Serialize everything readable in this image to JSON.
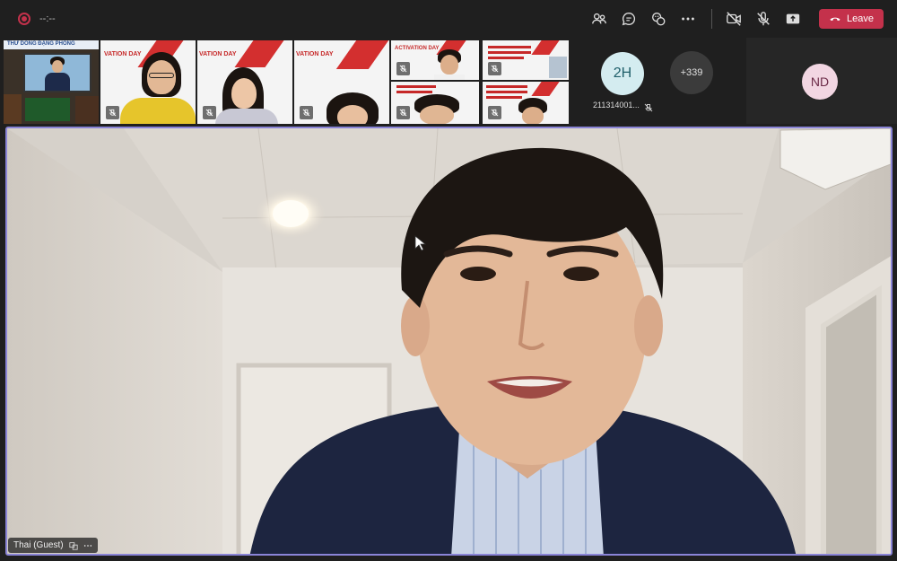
{
  "meeting": {
    "timer": "--:--",
    "leave_label": "Leave",
    "colors": {
      "accent_border": "#8a84d6",
      "leave": "#c4314b",
      "record": "#c4314b"
    }
  },
  "toolbar": {
    "icons": [
      "people-icon",
      "chat-icon",
      "reactions-icon",
      "more-icon",
      "camera-off-icon",
      "mic-off-icon",
      "share-icon",
      "phone-hangup-icon"
    ]
  },
  "participants": {
    "thumbnails": [
      {
        "name": "thumb-presentation",
        "banner": "THƯ DÒNG ĐẠNG PHÒNG",
        "muted": false
      },
      {
        "name": "thumb-girl-glasses",
        "banner": "VATION DAY",
        "muted": true
      },
      {
        "name": "thumb-girl-long-hair",
        "banner": "VATION DAY",
        "muted": true
      },
      {
        "name": "thumb-girl-partial",
        "banner": "VATION DAY",
        "muted": true
      },
      {
        "name": "thumb-boy-glasses",
        "banner": "ACTIVATION DAY",
        "muted": true
      },
      {
        "name": "thumb-slide-top",
        "banner": "",
        "muted": true
      },
      {
        "name": "thumb-boy-bottom",
        "banner": "",
        "muted": true
      },
      {
        "name": "thumb-slide-bottom",
        "banner": "",
        "muted": true
      }
    ],
    "avatars": [
      {
        "initials": "2H",
        "label": "211314001...",
        "muted": true
      },
      {
        "initials": "+339",
        "label": ""
      },
      {
        "initials": "ND",
        "label": ""
      }
    ]
  },
  "main_video": {
    "speaker_name": "Thai (Guest)"
  }
}
